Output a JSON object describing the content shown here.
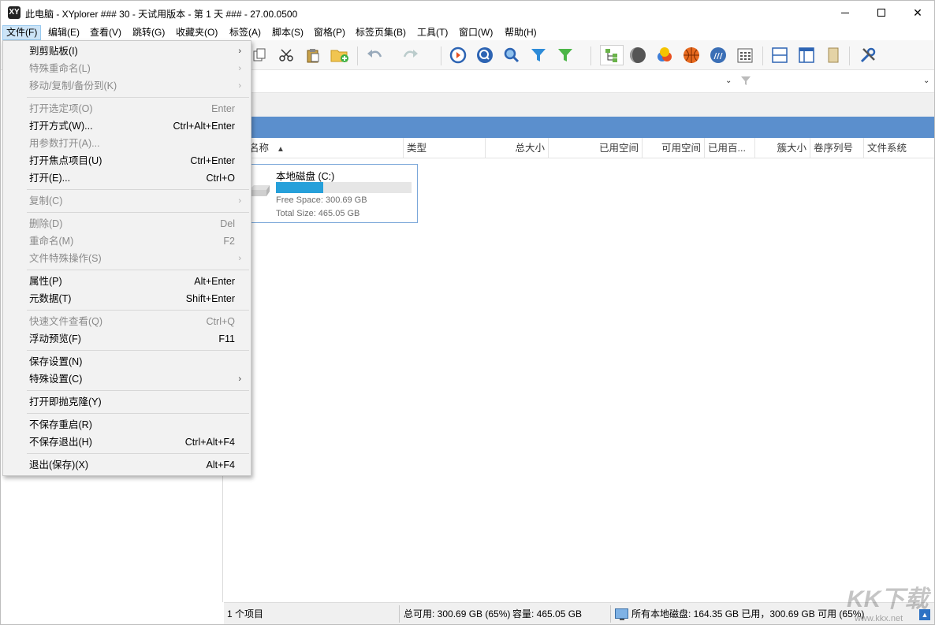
{
  "window": {
    "title": "此电脑 - XYplorer ### 30 - 天试用版本 - 第 1 天 ### - 27.00.0500",
    "logo": "XY"
  },
  "menubar": [
    {
      "label": "文件(F)",
      "active": true
    },
    {
      "label": "编辑(E)"
    },
    {
      "label": "查看(V)"
    },
    {
      "label": "跳转(G)"
    },
    {
      "label": "收藏夹(O)"
    },
    {
      "label": "标签(A)"
    },
    {
      "label": "脚本(S)"
    },
    {
      "label": "窗格(P)"
    },
    {
      "label": "标签页集(B)"
    },
    {
      "label": "工具(T)"
    },
    {
      "label": "窗口(W)"
    },
    {
      "label": "帮助(H)"
    }
  ],
  "file_menu": [
    {
      "label": "到剪贴板(I)",
      "shortcut": "",
      "submenu": true,
      "disabled": false
    },
    {
      "label": "特殊重命名(L)",
      "shortcut": "",
      "submenu": true,
      "disabled": true
    },
    {
      "label": "移动/复制/备份到(K)",
      "shortcut": "",
      "submenu": true,
      "disabled": true
    },
    {
      "sep": true
    },
    {
      "label": "打开选定项(O)",
      "shortcut": "Enter",
      "disabled": true
    },
    {
      "label": "打开方式(W)...",
      "shortcut": "Ctrl+Alt+Enter",
      "disabled": false
    },
    {
      "label": "用参数打开(A)...",
      "shortcut": "",
      "disabled": true
    },
    {
      "label": "打开焦点项目(U)",
      "shortcut": "Ctrl+Enter",
      "disabled": false
    },
    {
      "label": "打开(E)...",
      "shortcut": "Ctrl+O",
      "disabled": false
    },
    {
      "sep": true
    },
    {
      "label": "复制(C)",
      "shortcut": "",
      "submenu": true,
      "disabled": true
    },
    {
      "sep": true
    },
    {
      "label": "删除(D)",
      "shortcut": "Del",
      "disabled": true
    },
    {
      "label": "重命名(M)",
      "shortcut": "F2",
      "disabled": true
    },
    {
      "label": "文件特殊操作(S)",
      "shortcut": "",
      "submenu": true,
      "disabled": true
    },
    {
      "sep": true
    },
    {
      "label": "属性(P)",
      "shortcut": "Alt+Enter",
      "disabled": false
    },
    {
      "label": "元数据(T)",
      "shortcut": "Shift+Enter",
      "disabled": false
    },
    {
      "sep": true
    },
    {
      "label": "快速文件查看(Q)",
      "shortcut": "Ctrl+Q",
      "disabled": true
    },
    {
      "label": "浮动预览(F)",
      "shortcut": "F11",
      "disabled": false
    },
    {
      "sep": true
    },
    {
      "label": "保存设置(N)",
      "shortcut": "",
      "disabled": false
    },
    {
      "label": "特殊设置(C)",
      "shortcut": "",
      "submenu": true,
      "disabled": false
    },
    {
      "sep": true
    },
    {
      "label": "打开即抛克隆(Y)",
      "shortcut": "",
      "disabled": false
    },
    {
      "sep": true
    },
    {
      "label": "不保存重启(R)",
      "shortcut": "",
      "disabled": false
    },
    {
      "label": "不保存退出(H)",
      "shortcut": "Ctrl+Alt+F4",
      "disabled": false
    },
    {
      "sep": true
    },
    {
      "label": "退出(保存)(X)",
      "shortcut": "Alt+F4",
      "disabled": false
    }
  ],
  "columns": [
    {
      "label": "名称",
      "sort": "▲"
    },
    {
      "label": "类型"
    },
    {
      "label": "总大小"
    },
    {
      "label": "已用空间"
    },
    {
      "label": "可用空间"
    },
    {
      "label": "已用百..."
    },
    {
      "label": "簇大小"
    },
    {
      "label": "卷序列号"
    },
    {
      "label": "文件系统"
    }
  ],
  "drive": {
    "name": "本地磁盘 (C:)",
    "free": "Free Space: 300.69 GB",
    "total": "Total Size: 465.05 GB",
    "used_fraction": 0.35,
    "bar_color": "#26a0da"
  },
  "status": {
    "items": "1 个项目",
    "free": "总可用: 300.69 GB (65%)",
    "capacity": "容量: 465.05 GB",
    "all_drives": "所有本地磁盘: 164.35 GB 已用，300.69 GB 可用 (65%)"
  },
  "watermark": {
    "main": "KK下载",
    "sub": "www.kkx.net"
  },
  "colors": {
    "accent_blue": "#5b8fcd",
    "menu_highlight": "#cce4f7"
  }
}
